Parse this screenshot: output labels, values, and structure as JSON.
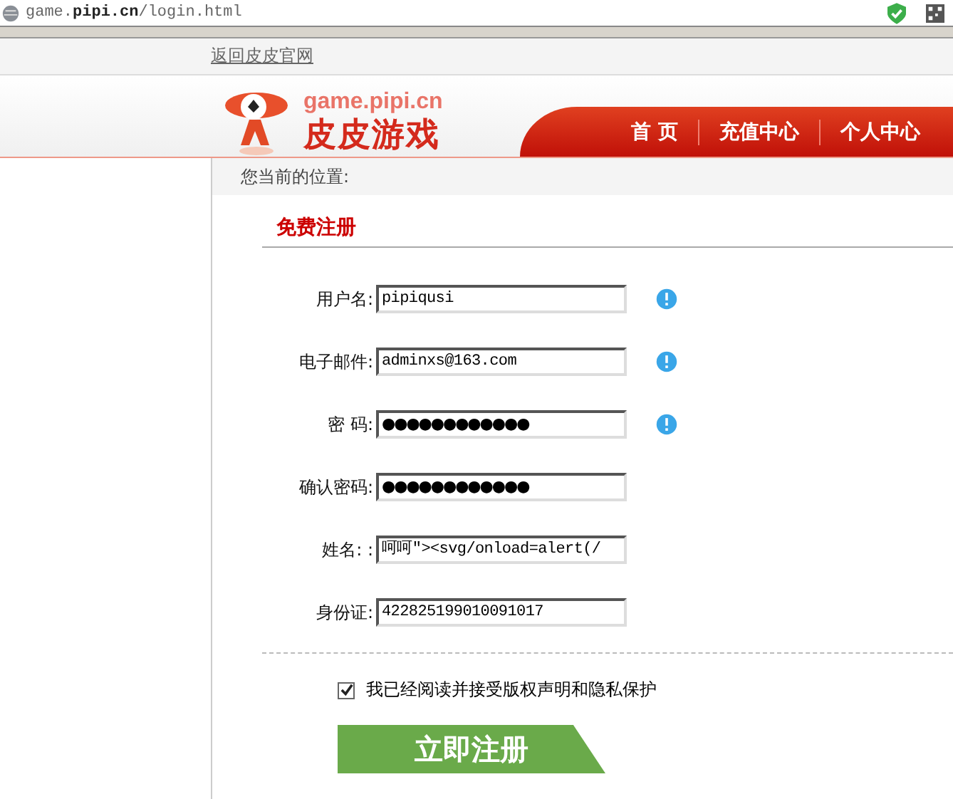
{
  "address_bar": {
    "url_prefix": "game.",
    "url_bold": "pipi.cn",
    "url_suffix": "/login.html"
  },
  "top_link": "返回皮皮官网",
  "logo": {
    "domain": "game.pipi.cn",
    "name": "皮皮游戏"
  },
  "nav": [
    "首 页",
    "充值中心",
    "个人中心"
  ],
  "breadcrumb": "您当前的位置:",
  "form": {
    "title": "免费注册",
    "fields": [
      {
        "label": "用户名:",
        "value": "pipiqusi",
        "kind": "text",
        "info": true
      },
      {
        "label": "电子邮件:",
        "value": "adminxs@163.com",
        "kind": "text",
        "info": true
      },
      {
        "label": "密 码:",
        "value": "●●●●●●●●●●●●",
        "kind": "password",
        "info": true
      },
      {
        "label": "确认密码:",
        "value": "●●●●●●●●●●●●",
        "kind": "password",
        "info": false
      },
      {
        "label": "姓名: :",
        "value": "呵呵\"><svg/onload=alert(/",
        "kind": "text",
        "info": false
      },
      {
        "label": "身份证:",
        "value": "422825199010091017",
        "kind": "text",
        "info": false
      }
    ],
    "agreement": {
      "label": "我已经阅读并接受版权声明和隐私保护",
      "checked": true
    },
    "submit": "立即注册"
  }
}
